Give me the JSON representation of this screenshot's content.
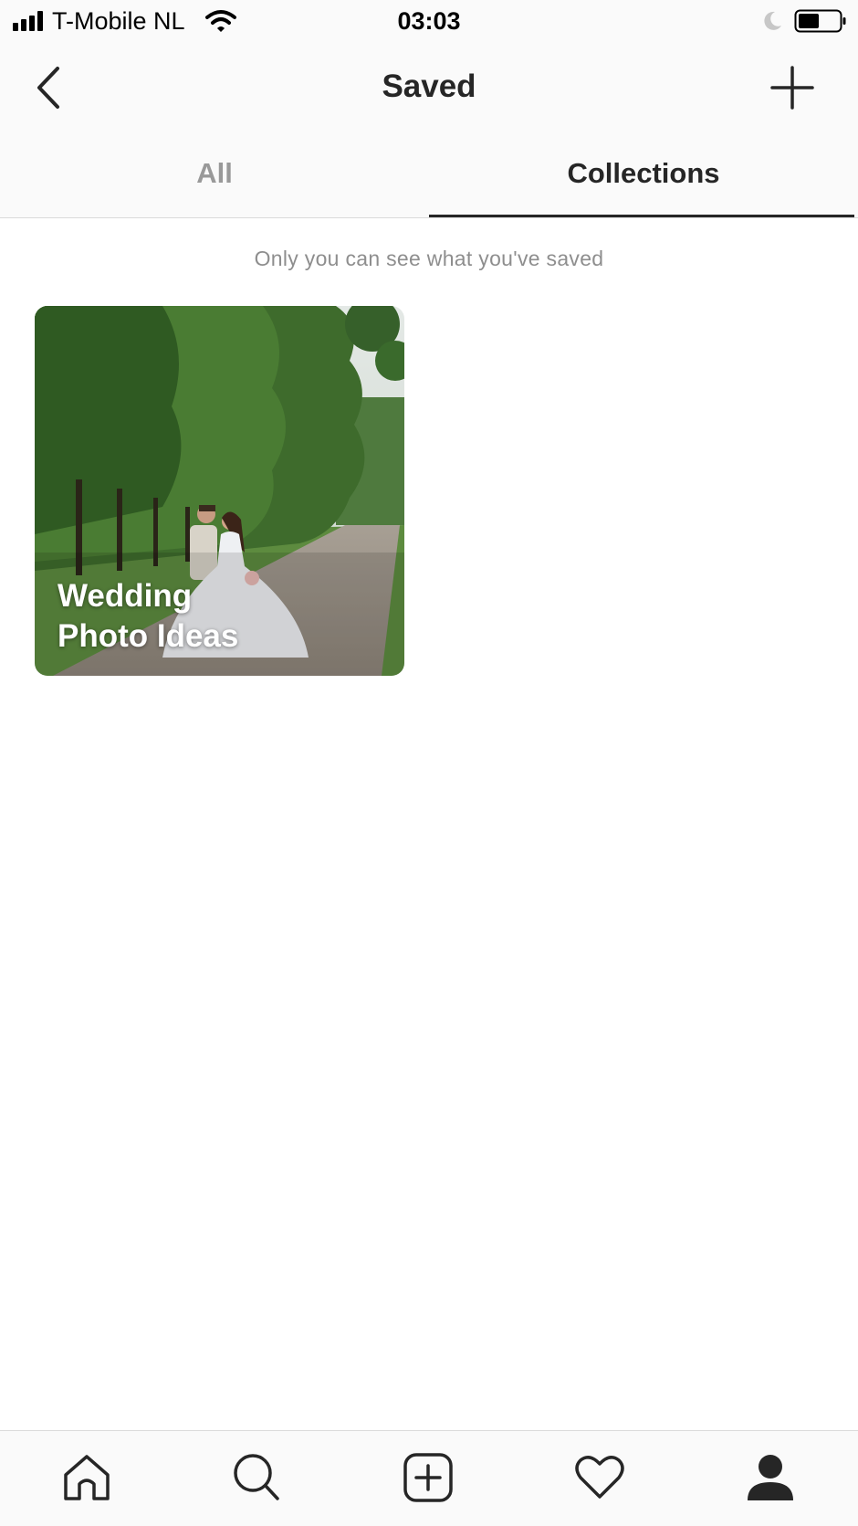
{
  "status_bar": {
    "carrier": "T-Mobile NL",
    "time": "03:03",
    "icons": [
      "signal-icon",
      "wifi-icon",
      "moon-icon",
      "battery-icon"
    ]
  },
  "nav": {
    "title": "Saved",
    "back_icon": "chevron-left-icon",
    "add_icon": "plus-icon"
  },
  "tabs": [
    {
      "label": "All",
      "selected": false
    },
    {
      "label": "Collections",
      "selected": true
    }
  ],
  "notice": "Only you can see what you've saved",
  "collections": [
    {
      "name": "Wedding\nPhoto Ideas"
    }
  ],
  "bottom_nav": [
    "home-icon",
    "search-icon",
    "new-post-icon",
    "activity-heart-icon",
    "profile-icon"
  ],
  "colors": {
    "text_primary": "#262626",
    "text_muted": "#8e8e8e",
    "tab_inactive": "#999999",
    "bar_background": "#fafafa",
    "divider": "#dbdbdb"
  }
}
